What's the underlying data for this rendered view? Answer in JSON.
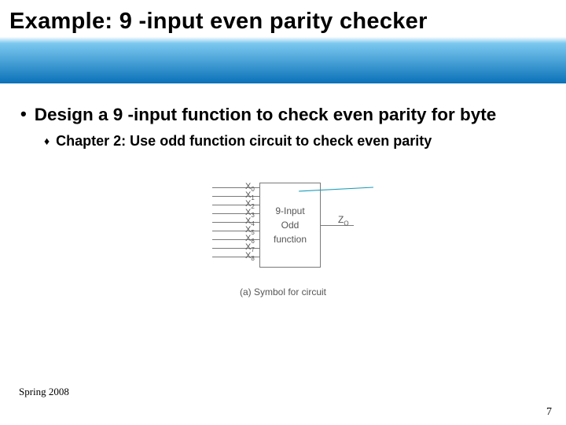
{
  "title": "Example: 9 -input even parity checker",
  "bullet": "Design a 9 -input function to check even parity for byte",
  "sub": "Chapter 2: Use odd function circuit to check even parity",
  "box": {
    "line1": "9-Input",
    "line2": "Odd",
    "line3": "function"
  },
  "inputs": [
    "0",
    "1",
    "2",
    "3",
    "4",
    "5",
    "6",
    "7",
    "8"
  ],
  "input_base": "X",
  "output_label": "Z",
  "output_sub": "O",
  "caption": "(a) Symbol for circuit",
  "footer": "Spring 2008",
  "page": "7"
}
